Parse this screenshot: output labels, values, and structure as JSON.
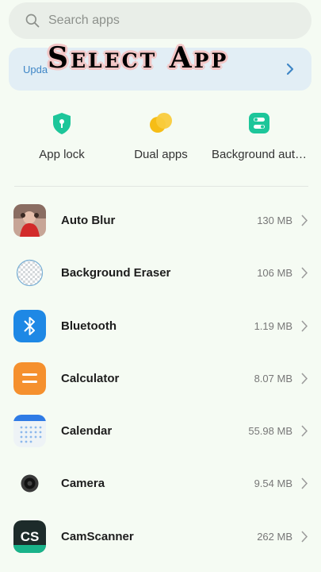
{
  "search": {
    "placeholder": "Search apps",
    "icon": "search-icon"
  },
  "banner": {
    "text": "Upda",
    "icon": "chevron-right-icon"
  },
  "overlay": {
    "title": "Select App"
  },
  "quick_actions": [
    {
      "label": "App lock",
      "icon": "shield-lock-icon",
      "color": "#1dc69a"
    },
    {
      "label": "Dual apps",
      "icon": "dual-circles-icon",
      "color": "#f6bd16"
    },
    {
      "label": "Background aut…",
      "icon": "toggle-switches-icon",
      "color": "#1dc69a"
    }
  ],
  "apps": [
    {
      "name": "Auto Blur",
      "size": "130 MB",
      "icon": "photo-thumbnail-icon"
    },
    {
      "name": "Background Eraser",
      "size": "106 MB",
      "icon": "checkered-circle-icon"
    },
    {
      "name": "Bluetooth",
      "size": "1.19 MB",
      "icon": "bluetooth-icon",
      "color": "#1e88e5"
    },
    {
      "name": "Calculator",
      "size": "8.07 MB",
      "icon": "calculator-icon",
      "color": "#f5902e"
    },
    {
      "name": "Calendar",
      "size": "55.98 MB",
      "icon": "calendar-icon",
      "color": "#2f7be5"
    },
    {
      "name": "Camera",
      "size": "9.54 MB",
      "icon": "camera-icon"
    },
    {
      "name": "CamScanner",
      "size": "262 MB",
      "icon": "camscanner-icon",
      "color": "#1d2b2a"
    }
  ]
}
